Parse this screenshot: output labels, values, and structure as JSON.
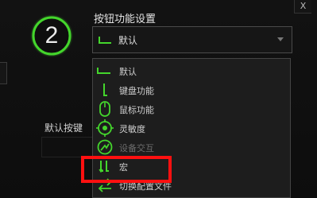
{
  "badge": {
    "number": "2",
    "ring_color": "#44d62c"
  },
  "header": {
    "title": "按钮功能设置",
    "close_label": "X"
  },
  "dropdown": {
    "selected": "默认",
    "icon": "default-arrow-icon"
  },
  "default_button": {
    "label": "默认按键"
  },
  "menu": {
    "items": [
      {
        "label": "默认",
        "icon": "default-arrow-icon",
        "enabled": true
      },
      {
        "label": "键盘功能",
        "icon": "keyboard-key-icon",
        "enabled": true
      },
      {
        "label": "鼠标功能",
        "icon": "mouse-icon",
        "enabled": true
      },
      {
        "label": "灵敏度",
        "icon": "sensitivity-icon",
        "enabled": true
      },
      {
        "label": "设备交互",
        "icon": "device-interaction-icon",
        "enabled": false
      },
      {
        "label": "宏",
        "icon": "macro-icon",
        "enabled": true
      },
      {
        "label": "切换配置文件",
        "icon": "switch-profile-icon",
        "enabled": true
      }
    ]
  },
  "highlight": {
    "target": "宏",
    "color": "#ff1010"
  },
  "colors": {
    "accent_green": "#44d62c",
    "background": "#0b0b0b"
  }
}
